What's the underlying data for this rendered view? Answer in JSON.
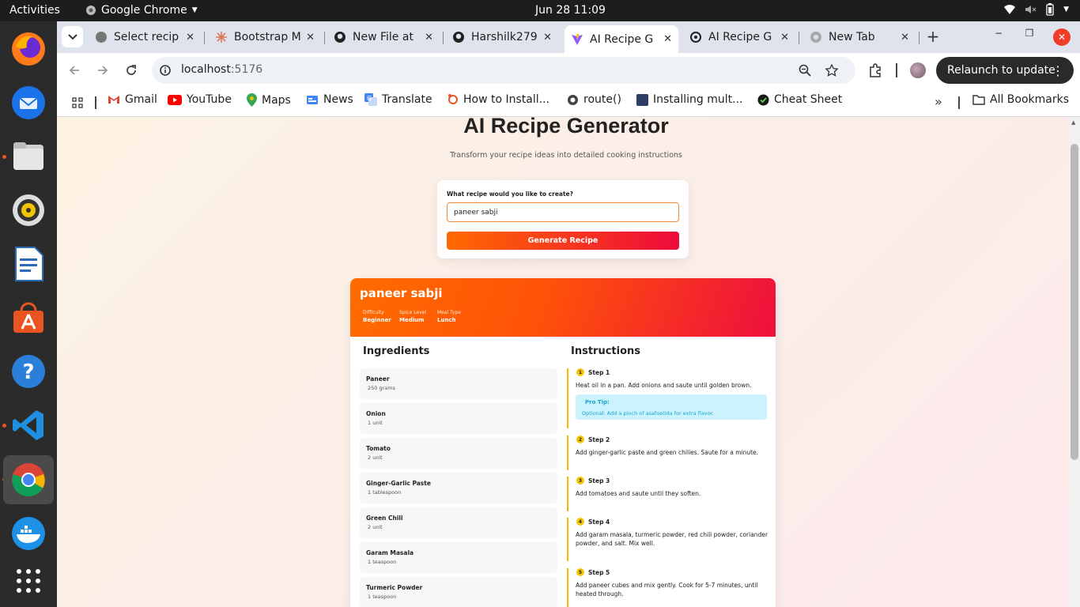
{
  "system": {
    "activities": "Activities",
    "app_name": "Google Chrome",
    "clock": "Jun 28  11:09"
  },
  "dock": {
    "items": [
      "firefox-icon",
      "thunderbird-icon",
      "files-icon",
      "rhythmbox-icon",
      "libreoffice-writer-icon",
      "app-center-icon",
      "help-icon",
      "vscode-icon",
      "chrome-icon",
      "docker-icon",
      "show-apps-icon"
    ]
  },
  "browser": {
    "tabs": [
      {
        "label": "Select recip"
      },
      {
        "label": "Bootstrap M"
      },
      {
        "label": "New File at"
      },
      {
        "label": "Harshilk279"
      },
      {
        "label": "AI Recipe G"
      },
      {
        "label": "AI Recipe G"
      },
      {
        "label": "New Tab"
      }
    ],
    "url_host": "localhost",
    "url_port": ":5176",
    "relaunch_label": "Relaunch to update",
    "bookmarks": [
      "Gmail",
      "YouTube",
      "Maps",
      "News",
      "Translate",
      "How to Install...",
      "route()",
      "Installing mult...",
      "Cheat Sheet"
    ],
    "all_bookmarks": "All Bookmarks"
  },
  "app": {
    "title": "AI Recipe Generator",
    "subtitle": "Transform your recipe ideas into detailed cooking instructions",
    "form": {
      "label": "What recipe would you like to create?",
      "input_value": "paneer sabji",
      "button_label": "Generate Recipe"
    },
    "recipe": {
      "name": "paneer sabji",
      "meta": [
        {
          "label": "Difficulty",
          "value": "Beginner"
        },
        {
          "label": "Spice Level",
          "value": "Medium"
        },
        {
          "label": "Meal Type",
          "value": "Lunch"
        }
      ],
      "ingredients_title": "Ingredients",
      "instructions_title": "Instructions",
      "ingredients": [
        {
          "name": "Paneer",
          "qty": "250 grams"
        },
        {
          "name": "Onion",
          "qty": "1 unit"
        },
        {
          "name": "Tomato",
          "qty": "2 unit"
        },
        {
          "name": "Ginger-Garlic Paste",
          "qty": "1 tablespoon"
        },
        {
          "name": "Green Chili",
          "qty": "2 unit"
        },
        {
          "name": "Garam Masala",
          "qty": "1 teaspoon"
        },
        {
          "name": "Turmeric Powder",
          "qty": "1 teaspoon"
        }
      ],
      "steps": [
        {
          "num": "1",
          "title": "Step 1",
          "text": "Heat oil in a pan. Add onions and saute until golden brown.",
          "tip_label": "Pro Tip:",
          "tip_text": "Optional: Add a pinch of asafoetida for extra flavor."
        },
        {
          "num": "2",
          "title": "Step 2",
          "text": "Add ginger-garlic paste and green chilies. Saute for a minute."
        },
        {
          "num": "3",
          "title": "Step 3",
          "text": "Add tomatoes and saute until they soften."
        },
        {
          "num": "4",
          "title": "Step 4",
          "text": "Add garam masala, turmeric powder, red chili powder, coriander powder, and salt. Mix well."
        },
        {
          "num": "5",
          "title": "Step 5",
          "text": "Add paneer cubes and mix gently. Cook for 5-7 minutes, until heated through."
        }
      ]
    }
  }
}
